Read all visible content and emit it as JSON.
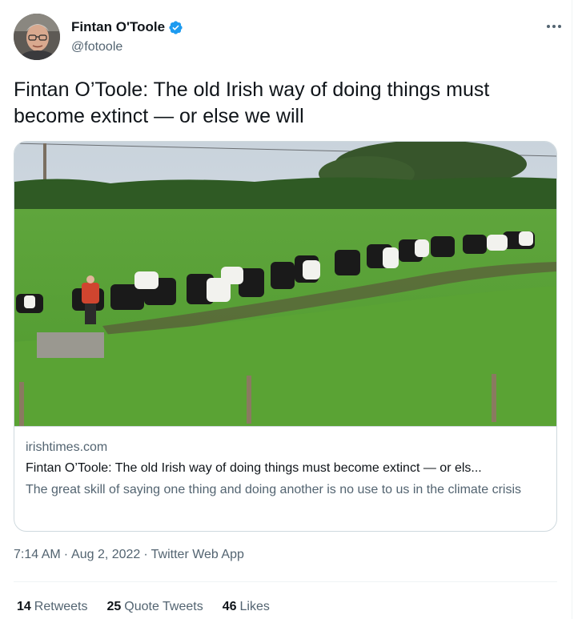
{
  "tweet": {
    "author": {
      "name": "Fintan O'Toole",
      "handle": "@fotoole",
      "verified": true
    },
    "text": "Fintan O’Toole: The old Irish way of doing things must become extinct — or else we will",
    "card": {
      "domain": "irishtimes.com",
      "title": "Fintan O’Toole: The old Irish way of doing things must become extinct — or els...",
      "description": "The great skill of saying one thing and doing another is no use to us in the climate crisis"
    },
    "meta": {
      "time": "7:14 AM",
      "date": "Aug 2, 2022",
      "source": "Twitter Web App",
      "separator": "·"
    },
    "stats": {
      "retweets": {
        "count": "14",
        "label": "Retweets"
      },
      "quote_tweets": {
        "count": "25",
        "label": "Quote Tweets"
      },
      "likes": {
        "count": "46",
        "label": "Likes"
      }
    }
  },
  "icons": {
    "verified": "verified-badge-icon",
    "more": "more-options-icon"
  },
  "colors": {
    "text_primary": "#0f1419",
    "text_secondary": "#536471",
    "verified_blue": "#1d9bf0",
    "border": "#cfd9de"
  }
}
